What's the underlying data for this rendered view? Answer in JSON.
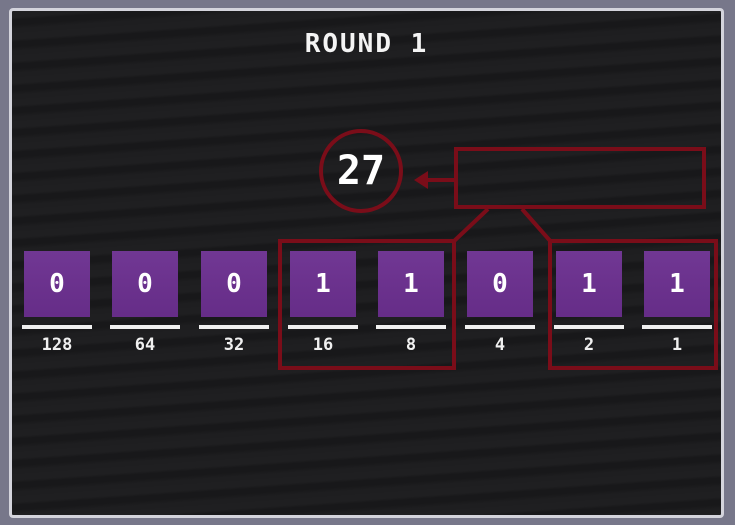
{
  "title": "ROUND 1",
  "total": "27",
  "answer_value": "",
  "bits": [
    {
      "value": "0",
      "weight": "128"
    },
    {
      "value": "0",
      "weight": "64"
    },
    {
      "value": "0",
      "weight": "32"
    },
    {
      "value": "1",
      "weight": "16"
    },
    {
      "value": "1",
      "weight": "8"
    },
    {
      "value": "0",
      "weight": "4"
    },
    {
      "value": "1",
      "weight": "2"
    },
    {
      "value": "1",
      "weight": "1"
    }
  ],
  "colors": {
    "tile": "#6b2f8f",
    "highlight": "#7a0d19",
    "background": "#1b1b1d",
    "text": "#ffffff"
  }
}
